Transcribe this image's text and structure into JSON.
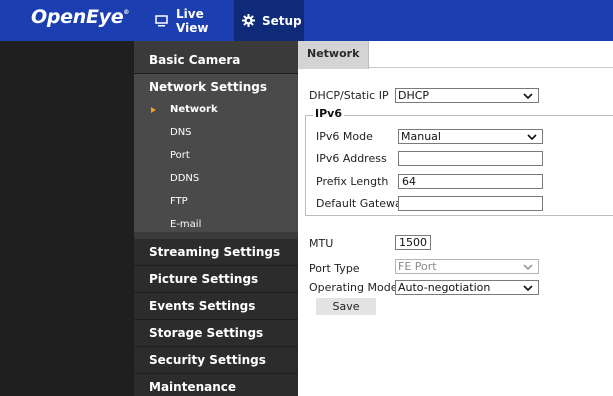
{
  "header": {
    "logo": "OpenEye",
    "logo_mark": "®",
    "nav": [
      {
        "label": "Live View",
        "icon": "monitor-icon"
      },
      {
        "label": "Setup",
        "icon": "gear-icon"
      }
    ],
    "colors": {
      "bar": "#1b3fb0",
      "active": "#0e2a78"
    }
  },
  "sidebar": {
    "sections": [
      {
        "label": "Basic Camera Settings"
      },
      {
        "label": "Network Settings"
      },
      {
        "label": "Streaming Settings"
      },
      {
        "label": "Picture Settings"
      },
      {
        "label": "Events Settings"
      },
      {
        "label": "Storage Settings"
      },
      {
        "label": "Security Settings"
      },
      {
        "label": "Maintenance"
      }
    ],
    "network_items": [
      {
        "label": "Network",
        "active": true
      },
      {
        "label": "DNS"
      },
      {
        "label": "Port"
      },
      {
        "label": "DDNS"
      },
      {
        "label": "FTP"
      },
      {
        "label": "E-mail"
      }
    ],
    "accent": "#f0a020"
  },
  "main": {
    "tab": "Network",
    "dhcp": {
      "label": "DHCP/Static IP",
      "value": "DHCP"
    },
    "ipv6": {
      "legend": "IPv6",
      "mode": {
        "label": "IPv6 Mode",
        "value": "Manual"
      },
      "address": {
        "label": "IPv6 Address",
        "value": ""
      },
      "prefix": {
        "label": "Prefix Length",
        "value": "64"
      },
      "gateway": {
        "label": "Default Gateway",
        "value": ""
      }
    },
    "mtu": {
      "label": "MTU",
      "value": "1500"
    },
    "port_type": {
      "label": "Port Type",
      "value": "FE Port"
    },
    "operating_mode": {
      "label": "Operating Mode",
      "value": "Auto-negotiation"
    },
    "save_label": "Save"
  }
}
